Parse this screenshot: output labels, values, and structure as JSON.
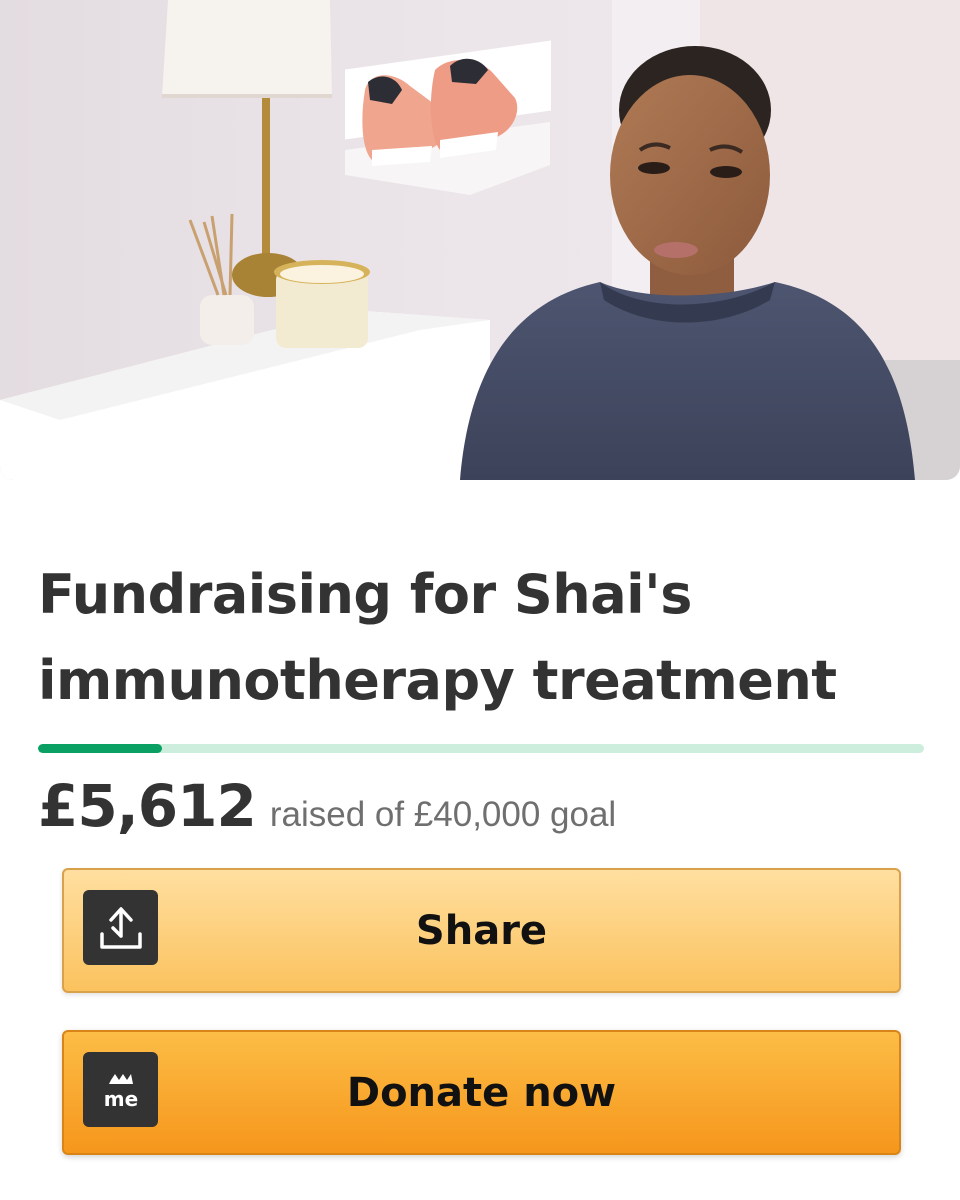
{
  "campaign": {
    "title_line1": "Fundraising for Shai's",
    "title_line2": "immunotherapy treatment",
    "raised_amount": "£5,612",
    "raised_text": "raised of £40,000 goal",
    "progress_fraction": 0.14
  },
  "actions": {
    "share_label": "Share",
    "donate_label": "Donate now",
    "share_icon": "share-upload-icon",
    "donate_icon": "gofundme-logo-icon"
  },
  "colors": {
    "progress_fill": "#0aa064",
    "progress_track": "#cdeedd",
    "share_button": "#fbc25e",
    "donate_button": "#f6961c",
    "title_text": "#333333"
  },
  "hero": {
    "logo_text": "me"
  }
}
